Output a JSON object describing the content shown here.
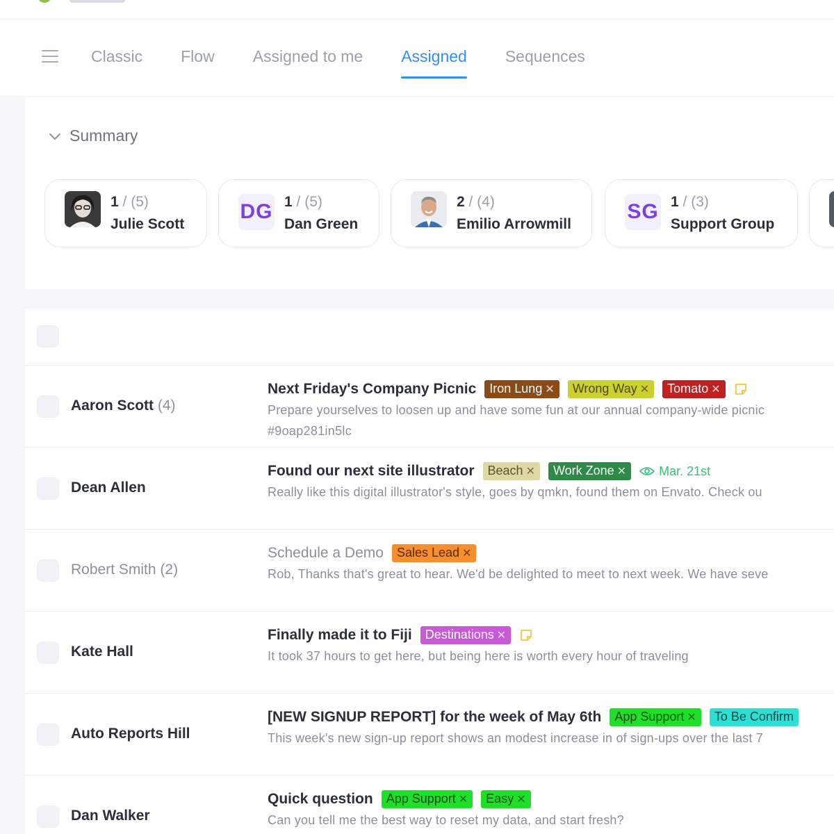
{
  "nav": {
    "tabs": [
      {
        "label": "Classic"
      },
      {
        "label": "Flow"
      },
      {
        "label": "Assigned to me"
      },
      {
        "label": "Assigned"
      },
      {
        "label": "Sequences"
      }
    ]
  },
  "summary": {
    "label": "Summary",
    "cards": [
      {
        "count": "1",
        "total": "(5)",
        "name": "Julie Scott"
      },
      {
        "initials": "DG",
        "count": "1",
        "total": "(5)",
        "name": "Dan Green"
      },
      {
        "count": "2",
        "total": "(4)",
        "name": "Emilio Arrowmill"
      },
      {
        "initials": "SG",
        "count": "1",
        "total": "(3)",
        "name": "Support Group"
      }
    ]
  },
  "rows": [
    {
      "sender": "Aaron Scott",
      "count": "(4)",
      "subject": "Next Friday's Company Picnic",
      "tags": [
        {
          "label": "Iron Lung",
          "color": "#8b4a16",
          "text_color": "#ffffff"
        },
        {
          "label": "Wrong Way",
          "color": "#cdd12e",
          "text_color": "#4a4a12"
        },
        {
          "label": "Tomato",
          "color": "#c0201f",
          "text_color": "#ffffff"
        }
      ],
      "preview": "Prepare yourselves to loosen up and have some fun at our annual company-wide picnic",
      "preview2": "#9oap281in5lc"
    },
    {
      "sender": "Dean Allen",
      "subject": "Found our next site illustrator",
      "tags": [
        {
          "label": "Beach",
          "color": "#ddd8a4",
          "text_color": "#5a5631"
        },
        {
          "label": "Work Zone",
          "color": "#2f8a48",
          "text_color": "#ffffff"
        }
      ],
      "due": "Mar. 21st",
      "preview": "Really like this digital illustrator's style, goes by qmkn, found them on Envato. Check ou"
    },
    {
      "sender": "Robert Smith",
      "count": "(2)",
      "subject": "Schedule a Demo",
      "tags": [
        {
          "label": "Sales Lead",
          "color": "#f58e2d",
          "text_color": "#5a2a00"
        }
      ],
      "preview": "Rob, Thanks that's great to hear. We'd be delighted to meet to next week. We have seve"
    },
    {
      "sender": "Kate Hall",
      "subject": "Finally made it to Fiji",
      "tags": [
        {
          "label": "Destinations",
          "color": "#c85ad6",
          "text_color": "#ffffff"
        }
      ],
      "preview": "It took 37 hours to get here, but being here is worth every hour of traveling"
    },
    {
      "sender": "Auto Reports Hill",
      "subject": "[NEW SIGNUP REPORT] for the week of May 6th",
      "tags": [
        {
          "label": "App Support",
          "color": "#1fe028",
          "text_color": "#1a4d12"
        },
        {
          "label": "To Be Confirm",
          "color": "#2ee0d4",
          "text_color": "#0f4a4a"
        }
      ],
      "preview": "This week's new sign-up report shows an modest increase in of sign-ups over the last 7"
    },
    {
      "sender": "Dan Walker",
      "subject": "Quick question",
      "tags": [
        {
          "label": "App Support",
          "color": "#1fe028",
          "text_color": "#1a4d12"
        },
        {
          "label": "Easy",
          "color": "#1fe028",
          "text_color": "#1a4d12"
        }
      ],
      "preview": "Can you tell me the best way to reset my data, and start fresh?"
    }
  ],
  "icons": {
    "menu": "menu-icon",
    "chevron": "chevron-down-icon",
    "note": "note-icon",
    "eye": "eye-icon",
    "close": "close-icon"
  },
  "colors": {
    "accent": "#2f8ff5",
    "initials": "#7b3fe4",
    "due": "#39c07a",
    "note": "#f4c542"
  }
}
